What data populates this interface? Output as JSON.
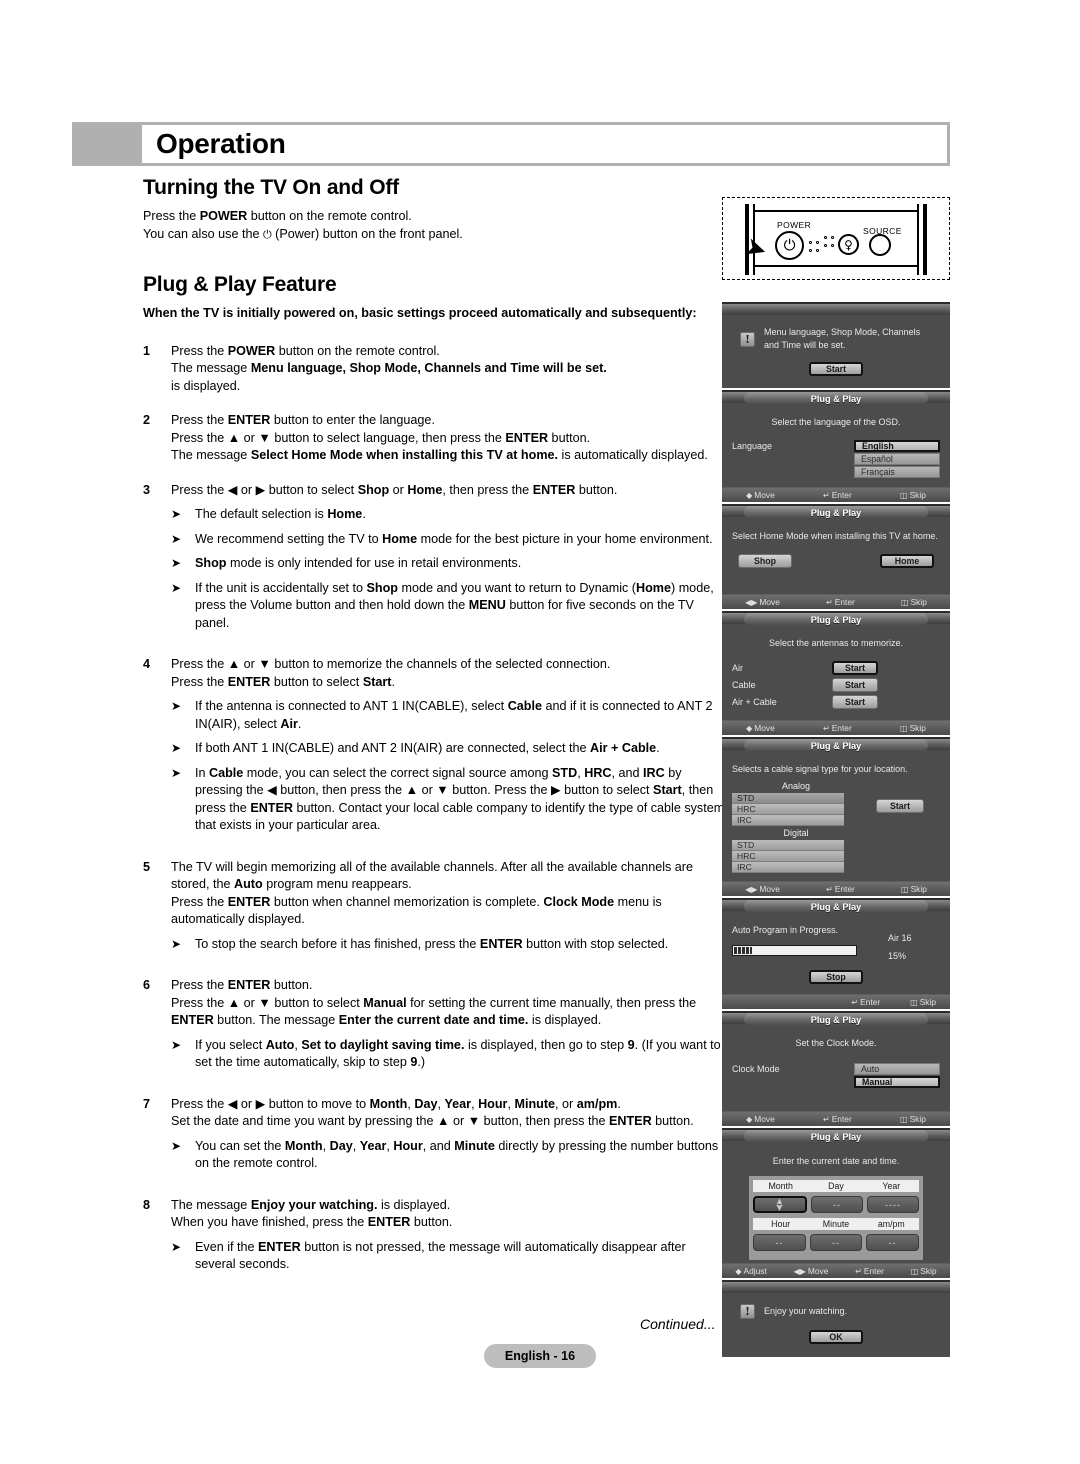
{
  "chapter": {
    "title": "Operation"
  },
  "sections": {
    "turning": {
      "title": "Turning the TV On and Off",
      "line1_a": "Press the ",
      "line1_b": "POWER",
      "line1_c": " button on the remote control.",
      "line2_a": "You can also use the ",
      "line2_icon": "⏻",
      "line2_b": " (Power) button on the front panel."
    },
    "plugplay": {
      "title": "Plug & Play Feature",
      "lead": "When the TV is initially powered on, basic settings proceed automatically and subsequently:"
    }
  },
  "steps": [
    {
      "num": "1",
      "lines": [
        "Press the POWER button on the remote control.",
        "The message Menu language, Shop Mode, Channels and Time will be set.",
        "is displayed."
      ],
      "bullets": []
    },
    {
      "num": "2",
      "lines": [
        "Press the ENTER button to enter the language.",
        "Press the ▲ or ▼ button to select language, then press the ENTER button.",
        "The message Select Home Mode when installing this TV at home. is automatically displayed."
      ],
      "bullets": []
    },
    {
      "num": "3",
      "lines": [
        "Press the ◀ or ▶ button to select Shop or Home, then press the ENTER button."
      ],
      "bullets": [
        "The default selection is Home.",
        "We recommend setting the TV to Home mode for the best picture in your home environment.",
        "Shop mode is only intended for use in retail environments.",
        "If the unit is accidentally set to Shop mode and you want to return to Dynamic (Home) mode, press the Volume button and then hold down the MENU button for five seconds on the TV panel."
      ]
    },
    {
      "num": "4",
      "lines": [
        "Press the ▲ or ▼ button to memorize the channels of the selected connection.",
        "Press the ENTER button to select Start."
      ],
      "bullets": [
        "If the antenna is connected to ANT 1 IN(CABLE), select Cable and if it is connected to ANT 2 IN(AIR), select Air.",
        "If both ANT 1 IN(CABLE) and ANT 2 IN(AIR) are connected, select the Air + Cable.",
        "In Cable mode, you can select the correct signal source among STD, HRC, and IRC by pressing the ◀ button, then press the ▲ or ▼ button. Press the ▶ button to select Start, then press the ENTER button. Contact your local cable company to identify the type of cable system that exists in your particular area."
      ]
    },
    {
      "num": "5",
      "lines": [
        "The TV will begin memorizing all of the available channels. After all the available channels are stored, the Auto program menu reappears.",
        "Press the ENTER button when channel memorization is complete. Clock Mode menu is automatically displayed."
      ],
      "bullets": [
        "To stop the search before it has finished, press the ENTER button with stop selected."
      ]
    },
    {
      "num": "6",
      "lines": [
        "Press the ENTER button.",
        "Press the ▲ or ▼ button to select Manual for setting the current time manually, then press the ENTER button. The message Enter the current date and time. is displayed."
      ],
      "bullets": [
        "If you select Auto, Set to daylight saving time. is displayed, then go to step 9. (If you want to set the time automatically, skip to step 9.)"
      ]
    },
    {
      "num": "7",
      "lines": [
        "Press the ◀ or ▶ button to move to Month, Day, Year, Hour, Minute, or am/pm.",
        "Set the date and time you want by pressing the ▲ or ▼ button, then press the ENTER button."
      ],
      "bullets": [
        "You can set the Month, Day, Year, Hour, and Minute directly by pressing the number buttons on the remote control."
      ]
    },
    {
      "num": "8",
      "lines": [
        "The message Enjoy your watching. is displayed.",
        "When you have finished, press the ENTER button."
      ],
      "bullets": [
        "Even if the ENTER button is not pressed, the message will automatically disappear after several seconds."
      ]
    }
  ],
  "front_panel": {
    "power_label": "POWER",
    "source_label": "SOURCE",
    "power_glyph": "⏻",
    "lamp_glyph": "♀"
  },
  "osd": {
    "title": "Plug & Play",
    "nav": {
      "move": "Move",
      "enter": "Enter",
      "skip": "Skip",
      "adjust": "Adjust"
    },
    "screen1": {
      "message": "Menu language, Shop Mode, Channels and Time will be set.",
      "button": "Start"
    },
    "screen2": {
      "message": "Select the language of the OSD.",
      "field_label": "Language",
      "options": [
        "English",
        "Español",
        "Français"
      ],
      "selected": "English"
    },
    "screen3": {
      "message": "Select Home Mode when installing this TV at home.",
      "shop": "Shop",
      "home": "Home"
    },
    "screen4": {
      "message": "Select the antennas to memorize.",
      "rows": [
        {
          "name": "Air",
          "button": "Start"
        },
        {
          "name": "Cable",
          "button": "Start"
        },
        {
          "name": "Air + Cable",
          "button": "Start"
        }
      ]
    },
    "screen5": {
      "message": "Selects a cable signal type for your location.",
      "analog_label": "Analog",
      "digital_label": "Digital",
      "analog": [
        "STD",
        "HRC",
        "IRC"
      ],
      "digital": [
        "STD",
        "HRC",
        "IRC"
      ],
      "button": "Start"
    },
    "screen6": {
      "message": "Auto Program in Progress.",
      "channel": "Air 16",
      "percent": "15%",
      "progress": 15,
      "button": "Stop"
    },
    "screen7": {
      "message": "Set the Clock Mode.",
      "field_label": "Clock Mode",
      "options": [
        "Auto",
        "Manual"
      ],
      "selected": "Manual"
    },
    "screen8": {
      "message": "Enter the current date and time.",
      "head_row1": [
        "Month",
        "Day",
        "Year"
      ],
      "vals_row1": [
        "--",
        "--",
        "----"
      ],
      "head_row2": [
        "Hour",
        "Minute",
        "am/pm"
      ],
      "vals_row2": [
        "--",
        "--",
        "--"
      ]
    },
    "screen9": {
      "message": "Enjoy your watching.",
      "button": "OK"
    }
  },
  "footer": {
    "continued": "Continued...",
    "page": "English - 16"
  }
}
